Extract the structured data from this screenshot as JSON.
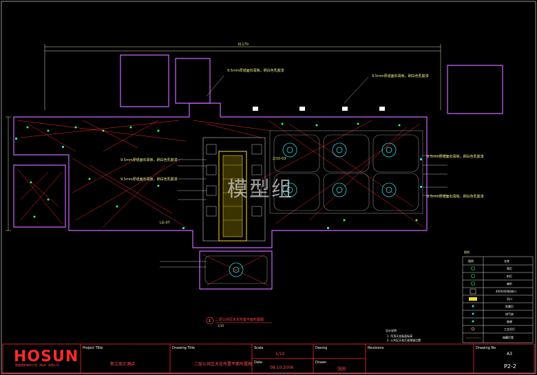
{
  "drawing": {
    "dimension_top": "31170",
    "notes": [
      "9.5mm厚纸面石膏板，刷白色乳胶漆",
      "9.5mm厚纸面石膏板，刷白色乳胶漆",
      "9.5mm厚纸面石膏板，刷白色乳胶漆",
      "9.5mm厚纸面石膏板，刷白色乳胶漆",
      "9.5mm厚纸面石膏板，刷白色乳胶漆",
      "9.5mm厚纸面石膏板，刷白色乳胶漆"
    ],
    "section_tag": "2/10-03",
    "section_tag_left": "LG-07",
    "plan_title": "二层公共区天花布置平面布置图",
    "plan_scale": "1/10",
    "plan_number": "1"
  },
  "legend": {
    "title": "图例",
    "header": [
      "图例",
      "名称"
    ],
    "rows": [
      {
        "name": "筒灯"
      },
      {
        "name": "射灯"
      },
      {
        "name": "喇叭"
      },
      {
        "name": "400X400检修口"
      },
      {
        "name": "风口"
      },
      {
        "name": "防雾灯"
      },
      {
        "name": "排气扇"
      },
      {
        "name": "烟感"
      },
      {
        "name": "工艺吊灯"
      },
      {
        "name": "暗藏灯管"
      }
    ]
  },
  "notes_block": {
    "title": "设计说明",
    "lines": [
      "1. 吊顶天花板面标高",
      "2. 公共区天花灯具预留位置"
    ]
  },
  "title_block": {
    "logo": "HOSUN",
    "logo_sub": "皓盛建筑装饰工程（株洲）有限公司",
    "project_title_label": "Project Title",
    "project_title": "新江商汇酒店",
    "drawing_title_label": "Drawing Title",
    "drawing_title": "二层公共区天花布置平面布置图",
    "scale_label": "Scale",
    "scale": "1/10",
    "date_label": "Date",
    "date": "08.10.2006",
    "design_label": "Desing",
    "drawn_label": "Drawn",
    "drawn": "张园",
    "revisions_label": "Revisions",
    "drawing_no_label": "Drawing No",
    "sheet_size": "A3",
    "drawing_no": "P2-2"
  },
  "watermark": "模型组"
}
